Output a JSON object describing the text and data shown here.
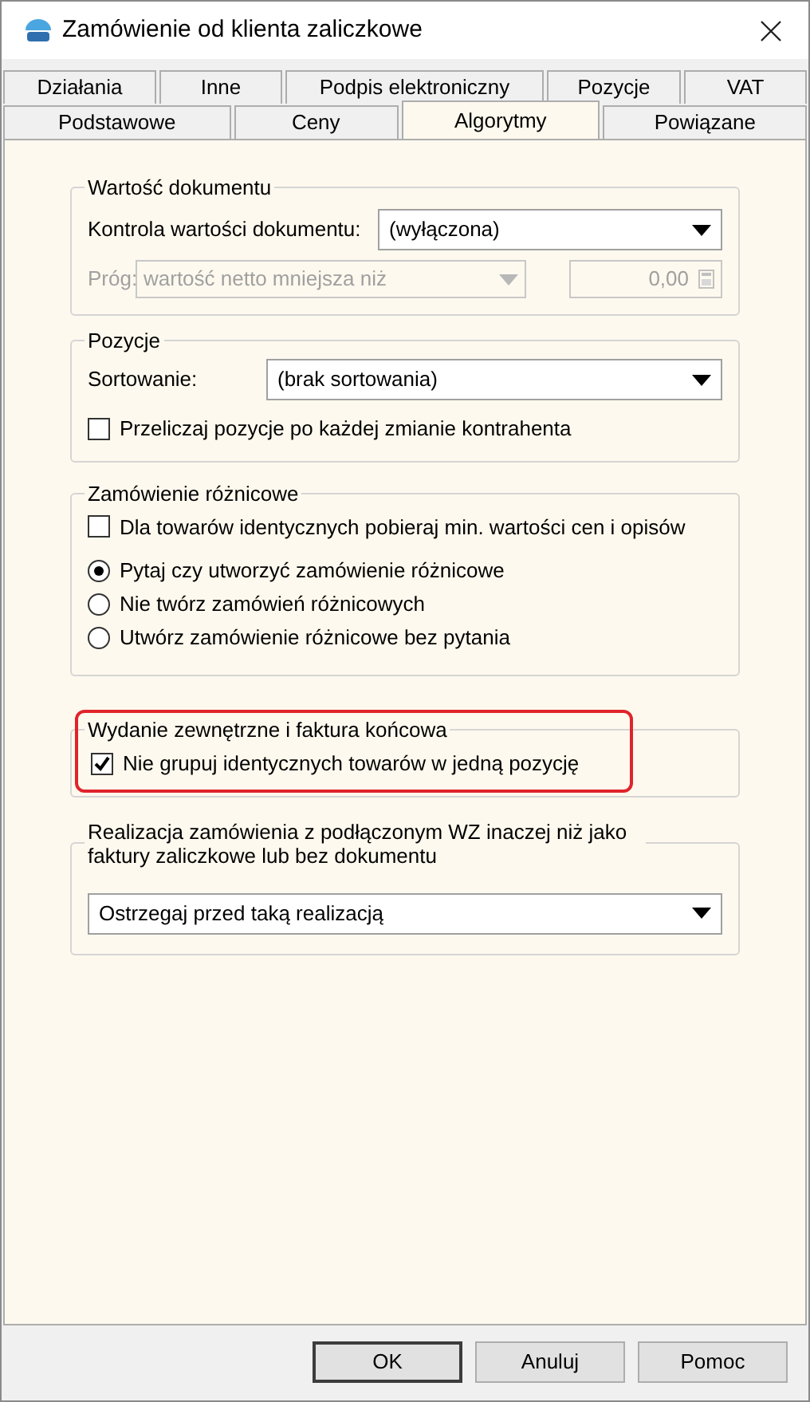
{
  "window": {
    "title": "Zamówienie od klienta zaliczkowe"
  },
  "tab_rows": [
    [
      {
        "label": "Działania",
        "selected": false
      },
      {
        "label": "Inne",
        "selected": false
      },
      {
        "label": "Podpis elektroniczny",
        "selected": false
      },
      {
        "label": "Pozycje",
        "selected": false
      },
      {
        "label": "VAT",
        "selected": false
      }
    ],
    [
      {
        "label": "Podstawowe",
        "selected": false
      },
      {
        "label": "Ceny",
        "selected": false
      },
      {
        "label": "Algorytmy",
        "selected": true
      },
      {
        "label": "Powiązane",
        "selected": false
      }
    ]
  ],
  "value_group": {
    "legend": "Wartość dokumentu",
    "control_label": "Kontrola wartości dokumentu:",
    "control_value": "(wyłączona)",
    "threshold_label": "Próg:",
    "threshold_value": "wartość netto mniejsza niż",
    "threshold_amount": "0,00",
    "threshold_disabled": true
  },
  "positions_group": {
    "legend": "Pozycje",
    "sort_label": "Sortowanie:",
    "sort_value": "(brak sortowania)",
    "recalc": {
      "label": "Przeliczaj pozycje po każdej zmianie kontrahenta",
      "checked": false
    }
  },
  "diff_group": {
    "legend": "Zamówienie różnicowe",
    "min_values": {
      "label": "Dla towarów identycznych pobieraj min. wartości cen i opisów",
      "checked": false
    },
    "options": [
      {
        "label": "Pytaj czy utworzyć zamówienie różnicowe",
        "selected": true
      },
      {
        "label": "Nie twórz zamówień różnicowych",
        "selected": false
      },
      {
        "label": "Utwórz zamówienie różnicowe bez pytania",
        "selected": false
      }
    ]
  },
  "release_group": {
    "legend": "Wydanie zewnętrzne i faktura końcowa",
    "highlighted": true,
    "no_group": {
      "label": "Nie grupuj identycznych towarów w jedną pozycję",
      "checked": true
    }
  },
  "realization_group": {
    "legend": "Realizacja zamówienia z podłączonym WZ inaczej niż jako faktury zaliczkowe lub bez dokumentu",
    "value": "Ostrzegaj przed taką realizacją"
  },
  "buttons": [
    {
      "label": "OK",
      "default": true
    },
    {
      "label": "Anuluj",
      "default": false
    },
    {
      "label": "Pomoc",
      "default": false
    }
  ]
}
